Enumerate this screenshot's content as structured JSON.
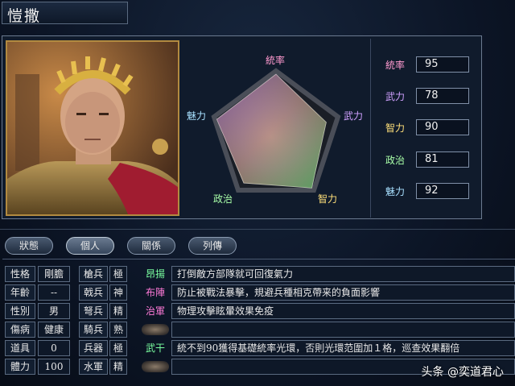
{
  "header": {
    "name": "愷撒"
  },
  "radar": {
    "labels": {
      "top": "統率",
      "right": "武力",
      "bottom_right": "智力",
      "bottom_left": "政治",
      "left": "魅力"
    },
    "label_colors": {
      "top": "#ff9ad0",
      "right": "#d0a0ff",
      "bottom_right": "#ffe07a",
      "bottom_left": "#a8ffa8",
      "left": "#a8e0ff"
    }
  },
  "stats": [
    {
      "name": "統率",
      "value": "95",
      "color": "#ff9ad0"
    },
    {
      "name": "武力",
      "value": "78",
      "color": "#d0a0ff"
    },
    {
      "name": "智力",
      "value": "90",
      "color": "#ffe07a"
    },
    {
      "name": "政治",
      "value": "81",
      "color": "#a8ffa8"
    },
    {
      "name": "魅力",
      "value": "92",
      "color": "#a8e0ff"
    }
  ],
  "tabs": [
    "狀態",
    "個人",
    "關係",
    "列傳"
  ],
  "active_tab": 1,
  "personal": [
    {
      "label": "性格",
      "value": "剛膽"
    },
    {
      "label": "年齡",
      "value": "--"
    },
    {
      "label": "性別",
      "value": "男"
    },
    {
      "label": "傷病",
      "value": "健康"
    },
    {
      "label": "道具",
      "value": "0"
    },
    {
      "label": "體力",
      "value": "100"
    }
  ],
  "troops": [
    {
      "label": "槍兵",
      "value": "極"
    },
    {
      "label": "戟兵",
      "value": "神"
    },
    {
      "label": "弩兵",
      "value": "精"
    },
    {
      "label": "騎兵",
      "value": "熟"
    },
    {
      "label": "兵器",
      "value": "極"
    },
    {
      "label": "水軍",
      "value": "精"
    }
  ],
  "skills": [
    {
      "name": "昂揚",
      "color": "#7affa0",
      "desc": "打倒敵方部隊就可回復氣力"
    },
    {
      "name": "布陣",
      "color": "#ff7ad8",
      "desc": "防止被戰法暴擊，規避兵種相克帶来的負面影響"
    },
    {
      "name": "治軍",
      "color": "#ff7ad8",
      "desc": "物理攻擊眩暈效果免疫"
    },
    {
      "name": "",
      "color": "",
      "desc": ""
    },
    {
      "name": "武干",
      "color": "#7affa0",
      "desc": "統不到90獲得基礎統率光環，否則光環范圍加１格，巡查效果翻倍"
    },
    {
      "name": "",
      "color": "",
      "desc": ""
    }
  ],
  "watermark": "头条 @奕道君心"
}
